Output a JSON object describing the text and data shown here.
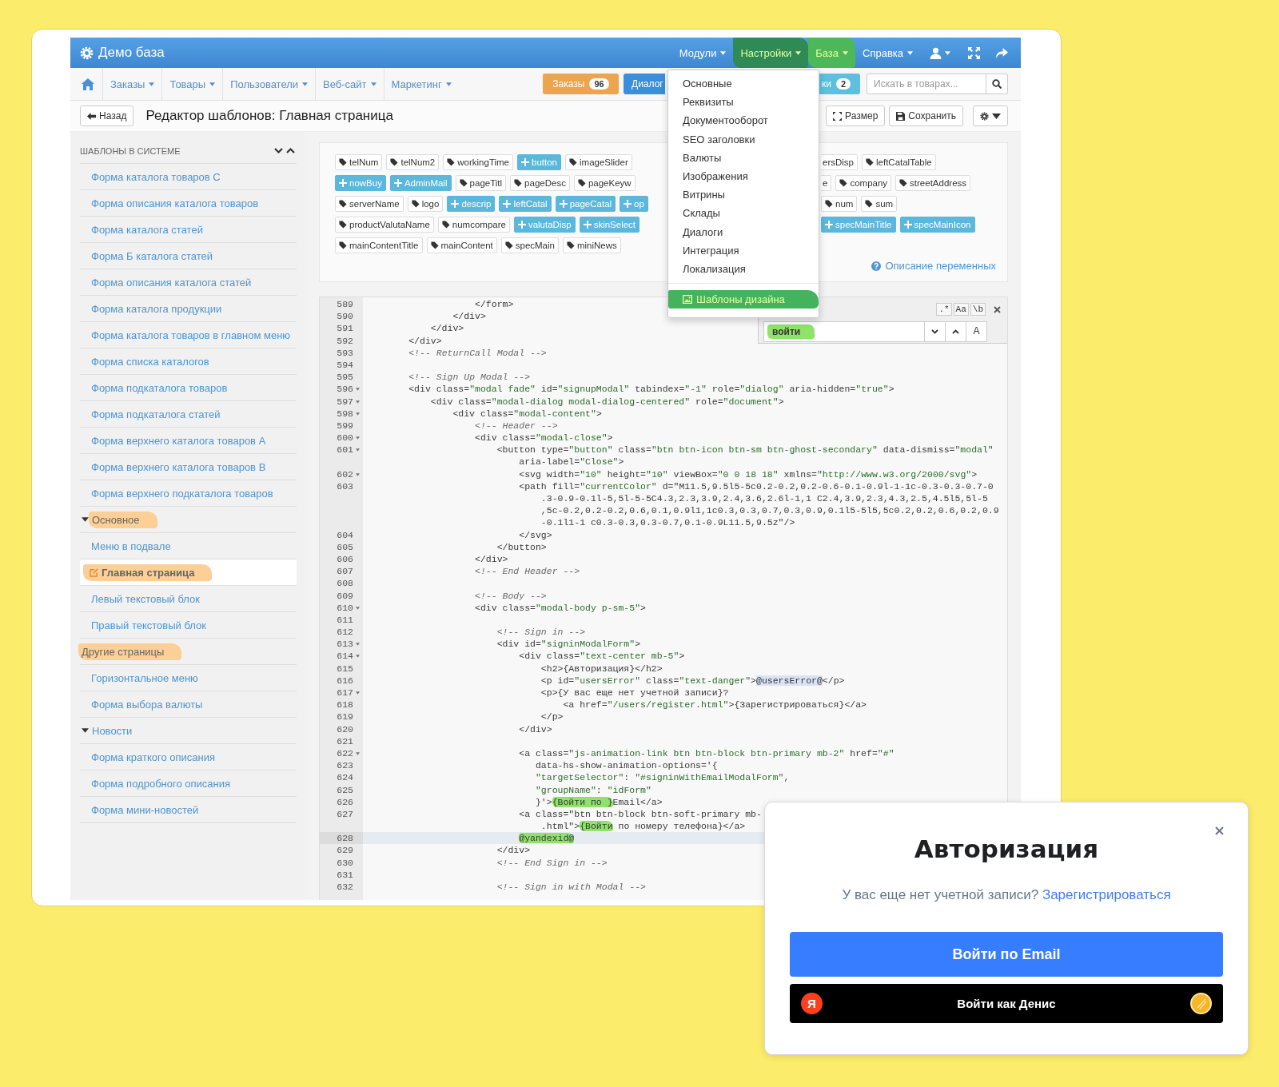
{
  "top_bar": {
    "title": "Демо база",
    "menus": [
      {
        "label": "Модули",
        "selected": false,
        "marked": false
      },
      {
        "label": "Настройки",
        "selected": true,
        "marked": true
      },
      {
        "label": "База",
        "selected": false,
        "marked": true
      },
      {
        "label": "Справка",
        "selected": false,
        "marked": false
      }
    ]
  },
  "nav": {
    "items": [
      "Заказы",
      "Товары",
      "Пользователи",
      "Веб-сайт",
      "Маркетинг"
    ],
    "buttons": [
      {
        "kind": "warning",
        "label": "Заказы",
        "count": "96"
      },
      {
        "kind": "primary",
        "label": "Диалог"
      },
      {
        "kind": "info",
        "label": "ки",
        "count": "2"
      }
    ],
    "search": {
      "placeholder": "Искать в товарах..."
    }
  },
  "page_header": {
    "back": "Назад",
    "title": "Редактор шаблонов: Главная страница",
    "actions": [
      {
        "kind": "resize",
        "label": "Размер"
      },
      {
        "kind": "save",
        "label": "Сохранить"
      },
      {
        "kind": "settings"
      }
    ]
  },
  "sidebar": {
    "title": "ШАБЛОНЫ В СИСТЕМЕ",
    "items": [
      {
        "label": "Форма каталога товаров С",
        "selected": false,
        "marked": false
      },
      {
        "label": "Форма описания каталога товаров",
        "selected": false,
        "marked": false
      },
      {
        "label": "Форма каталога статей",
        "selected": false,
        "marked": false
      },
      {
        "label": "Форма Б каталога статей",
        "selected": false,
        "marked": false
      },
      {
        "label": "Форма описания каталога статей",
        "selected": false,
        "marked": false
      },
      {
        "label": "Форма каталога продукции",
        "selected": false,
        "marked": false
      },
      {
        "label": "Форма каталога товаров в главном меню",
        "selected": false,
        "marked": false
      },
      {
        "label": "Форма списка каталогов",
        "selected": false,
        "marked": false
      },
      {
        "label": "Форма подкаталога товаров",
        "selected": false,
        "marked": false
      },
      {
        "label": "Форма подкаталога статей",
        "selected": false,
        "marked": false
      },
      {
        "label": "Форма верхнего каталога товаров А",
        "selected": false,
        "marked": false
      },
      {
        "label": "Форма верхнего каталога товаров В",
        "selected": false,
        "marked": false
      },
      {
        "label": "Форма верхнего подкаталога товаров",
        "selected": false,
        "marked": false
      },
      {
        "label": "Основное",
        "kind": "group",
        "expanded": true,
        "selected": false,
        "marked": true,
        "children": [
          {
            "label": "Меню в подвале",
            "selected": false,
            "marked": false
          },
          {
            "label": "Главная страница",
            "selected": true,
            "marked": true
          },
          {
            "label": "Левый текстовый блок",
            "selected": false,
            "marked": false
          },
          {
            "label": "Правый текстовый блок",
            "selected": false,
            "marked": false
          }
        ]
      },
      {
        "label": "Другие страницы",
        "kind": "group",
        "selected": false,
        "marked": true,
        "children": [
          {
            "label": "Горизонтальное меню",
            "selected": false,
            "marked": false
          },
          {
            "label": "Форма выбора валюты",
            "selected": false,
            "marked": false
          }
        ]
      },
      {
        "label": "Новости",
        "kind": "group",
        "expanded": true,
        "selected": false,
        "marked": false,
        "children": [
          {
            "label": "Форма краткого описания",
            "selected": false,
            "marked": false
          },
          {
            "label": "Форма подробного описания",
            "selected": false,
            "marked": false
          },
          {
            "label": "Форма мини-новостей",
            "selected": false,
            "marked": false
          }
        ]
      }
    ]
  },
  "variables": {
    "rows": [
      {
        "left": [
          {
            "kind": "var",
            "label": "telNum"
          },
          {
            "kind": "var",
            "label": "telNum2"
          },
          {
            "kind": "var",
            "label": "workingTime"
          },
          {
            "kind": "add",
            "label": "button"
          },
          {
            "kind": "var",
            "label": "imageSlider"
          }
        ],
        "right": [
          {
            "kind": "cut",
            "label": "ersDisp"
          },
          {
            "kind": "var",
            "label": "leftCatalTable"
          }
        ]
      },
      {
        "left": [
          {
            "kind": "add",
            "label": "nowBuy"
          },
          {
            "kind": "add",
            "label": "AdminMail"
          },
          {
            "kind": "var",
            "label": "pageTitl"
          },
          {
            "kind": "var",
            "label": "pageDesc"
          },
          {
            "kind": "var",
            "label": "pageKeyw"
          }
        ],
        "right": [
          {
            "kind": "cut",
            "label": "e"
          },
          {
            "kind": "var",
            "label": "company"
          },
          {
            "kind": "var",
            "label": "streetAddress"
          }
        ]
      },
      {
        "left": [
          {
            "kind": "var",
            "label": "serverName"
          },
          {
            "kind": "var",
            "label": "logo"
          },
          {
            "kind": "add",
            "label": "descrip"
          },
          {
            "kind": "add",
            "label": "leftCatal"
          },
          {
            "kind": "add",
            "label": "pageCatal"
          },
          {
            "kind": "add",
            "label": "op"
          }
        ],
        "right": [
          {
            "kind": "var",
            "label": "num"
          },
          {
            "kind": "var",
            "label": "sum"
          }
        ]
      },
      {
        "left": [
          {
            "kind": "var",
            "label": "productValutaName"
          },
          {
            "kind": "var",
            "label": "numcompare"
          },
          {
            "kind": "add",
            "label": "valutaDisp"
          },
          {
            "kind": "add",
            "label": "skinSelect"
          }
        ],
        "right": [
          {
            "kind": "add",
            "label": "specMainTitle"
          },
          {
            "kind": "add",
            "label": "specMainIcon"
          }
        ]
      },
      {
        "left": [
          {
            "kind": "var",
            "label": "mainContentTitle"
          },
          {
            "kind": "var",
            "label": "mainContent"
          },
          {
            "kind": "var",
            "label": "specMain"
          },
          {
            "kind": "var",
            "label": "miniNews"
          }
        ],
        "right": []
      }
    ],
    "help_link": "Описание переменных"
  },
  "settings_menu": {
    "items": [
      {
        "kind": "item",
        "label": "Основные",
        "selected": false,
        "marked": false
      },
      {
        "kind": "item",
        "label": "Реквизиты",
        "selected": false,
        "marked": false
      },
      {
        "kind": "item",
        "label": "Документооборот",
        "selected": false,
        "marked": false
      },
      {
        "kind": "item",
        "label": "SEO заголовки",
        "selected": false,
        "marked": false
      },
      {
        "kind": "item",
        "label": "Валюты",
        "selected": false,
        "marked": false
      },
      {
        "kind": "item",
        "label": "Изображения",
        "selected": false,
        "marked": false
      },
      {
        "kind": "item",
        "label": "Витрины",
        "selected": false,
        "marked": false
      },
      {
        "kind": "item",
        "label": "Склады",
        "selected": false,
        "marked": false
      },
      {
        "kind": "item",
        "label": "Диалоги",
        "selected": false,
        "marked": false
      },
      {
        "kind": "item",
        "label": "Интеграция",
        "selected": false,
        "marked": false
      },
      {
        "kind": "item",
        "label": "Локализация",
        "selected": false,
        "marked": false
      },
      {
        "kind": "divider"
      },
      {
        "kind": "item",
        "label": "Шаблоны дизайна",
        "selected": true,
        "marked": true
      }
    ]
  },
  "editor": {
    "search": {
      "options": [
        ".*",
        "Aa",
        "\\b"
      ],
      "value": "войти",
      "marked": true,
      "button": "A"
    },
    "lines": [
      {
        "num": "589",
        "fold": false,
        "active": false,
        "text": "                    </form>"
      },
      {
        "num": "590",
        "fold": false,
        "active": false,
        "text": "                </div>"
      },
      {
        "num": "591",
        "fold": false,
        "active": false,
        "text": "            </div>"
      },
      {
        "num": "592",
        "fold": false,
        "active": false,
        "text": "        </div>"
      },
      {
        "num": "593",
        "fold": false,
        "active": false,
        "text": "        <!-- ReturnCall Modal -->"
      },
      {
        "num": "594",
        "fold": false,
        "active": false
      },
      {
        "num": "595",
        "fold": false,
        "active": false,
        "text": "        <!-- Sign Up Modal -->"
      },
      {
        "num": "596",
        "fold": true,
        "active": false,
        "text": "        <div class=\"modal fade\" id=\"signupModal\" tabindex=\"-1\" role=\"dialog\" aria-hidden=\"true\">"
      },
      {
        "num": "597",
        "fold": true,
        "active": false,
        "text": "            <div class=\"modal-dialog modal-dialog-centered\" role=\"document\">"
      },
      {
        "num": "598",
        "fold": true,
        "active": false,
        "text": "                <div class=\"modal-content\">"
      },
      {
        "num": "599",
        "fold": false,
        "active": false,
        "text": "                    <!-- Header -->"
      },
      {
        "num": "600",
        "fold": true,
        "active": false,
        "text": "                    <div class=\"modal-close\">"
      },
      {
        "num": "601",
        "fold": true,
        "active": false,
        "text": "                        <button type=\"button\" class=\"btn btn-icon btn-sm btn-ghost-secondary\" data-dismiss=\"modal\""
      },
      {
        "fold": false,
        "active": false,
        "text": "                            aria-label=\"Close\">"
      },
      {
        "num": "602",
        "fold": true,
        "active": false,
        "text": "                            <svg width=\"10\" height=\"10\" viewBox=\"0 0 18 18\" xmlns=\"http://www.w3.org/2000/svg\">"
      },
      {
        "num": "603",
        "fold": false,
        "active": false,
        "text": "                            <path fill=\"currentColor\" d=\"M11.5,9.5l5-5c0.2-0.2,0.2-0.6-0.1-0.9l-1-1c-0.3-0.3-0.7-0"
      },
      {
        "fold": false,
        "active": false,
        "text": "                                .3-0.9-0.1l-5,5l-5-5C4.3,2.3,3.9,2.4,3.6,2.6l-1,1 C2.4,3.9,2.3,4.3,2.5,4.5l5,5l-5"
      },
      {
        "fold": false,
        "active": false,
        "text": "                                ,5c-0.2,0.2-0.2,0.6,0.1,0.9l1,1c0.3,0.3,0.7,0.3,0.9,0.1l5-5l5,5c0.2,0.2,0.6,0.2,0.9"
      },
      {
        "fold": false,
        "active": false,
        "text": "                                -0.1l1-1 c0.3-0.3,0.3-0.7,0.1-0.9L11.5,9.5z\"/>"
      },
      {
        "num": "604",
        "fold": false,
        "active": false,
        "text": "                            </svg>"
      },
      {
        "num": "605",
        "fold": false,
        "active": false,
        "text": "                        </button>"
      },
      {
        "num": "606",
        "fold": false,
        "active": false,
        "text": "                    </div>"
      },
      {
        "num": "607",
        "fold": false,
        "active": false,
        "text": "                    <!-- End Header -->"
      },
      {
        "num": "608",
        "fold": false,
        "active": false
      },
      {
        "num": "609",
        "fold": false,
        "active": false,
        "text": "                    <!-- Body -->"
      },
      {
        "num": "610",
        "fold": true,
        "active": false,
        "text": "                    <div class=\"modal-body p-sm-5\">"
      },
      {
        "num": "611",
        "fold": false,
        "active": false
      },
      {
        "num": "612",
        "fold": false,
        "active": false,
        "text": "                        <!-- Sign in -->"
      },
      {
        "num": "613",
        "fold": true,
        "active": false,
        "text": "                        <div id=\"signinModalForm\">"
      },
      {
        "num": "614",
        "fold": true,
        "active": false,
        "text": "                            <div class=\"text-center mb-5\">"
      },
      {
        "num": "615",
        "fold": false,
        "active": false,
        "text": "                                <h2>{Авторизация}</h2>"
      },
      {
        "num": "616",
        "fold": false,
        "active": false,
        "parts": [
          {
            "text": "                                <p id=\"usersError\" class=\"text-danger\">"
          },
          {
            "text": "@usersError@",
            "match": true
          },
          {
            "text": "</p>"
          }
        ]
      },
      {
        "num": "617",
        "fold": true,
        "active": false,
        "text": "                                <p>{У вас еще нет учетной записи}?"
      },
      {
        "num": "618",
        "fold": false,
        "active": false,
        "text": "                                    <a href=\"/users/register.html\">{Зарегистрироваться}</a>"
      },
      {
        "num": "619",
        "fold": false,
        "active": false,
        "text": "                                </p>"
      },
      {
        "num": "620",
        "fold": false,
        "active": false,
        "text": "                            </div>"
      },
      {
        "num": "621",
        "fold": false,
        "active": false
      },
      {
        "num": "622",
        "fold": true,
        "active": false,
        "text": "                            <a class=\"js-animation-link btn btn-block btn-primary mb-2\" href=\"#\""
      },
      {
        "num": "623",
        "fold": false,
        "active": false,
        "text": "                               data-hs-show-animation-options='{"
      },
      {
        "num": "624",
        "fold": false,
        "active": false,
        "text": "                               \"targetSelector\": \"#signinWithEmailModalForm\","
      },
      {
        "num": "625",
        "fold": false,
        "active": false,
        "text": "                               \"groupName\": \"idForm\""
      },
      {
        "num": "626",
        "fold": false,
        "active": false,
        "parts": [
          {
            "text": "                               }'>"
          },
          {
            "text": "{Войти по }",
            "marked": true
          },
          {
            "text": "Email</a>"
          }
        ]
      },
      {
        "num": "627",
        "fold": false,
        "active": false,
        "text": "                            <a class=\"btn btn-block btn-soft-primary mb-"
      },
      {
        "fold": false,
        "active": false,
        "parts": [
          {
            "text": "                                .html\">"
          },
          {
            "text": "{Войти",
            "marked": true
          },
          {
            "text": " по номеру телефона}</a>"
          }
        ]
      },
      {
        "num": "628",
        "fold": false,
        "active": true,
        "parts": [
          {
            "text": "                            @yandexid@",
            "marked": true
          }
        ]
      },
      {
        "num": "629",
        "fold": false,
        "active": false,
        "text": "                        </div>"
      },
      {
        "num": "630",
        "fold": false,
        "active": false,
        "text": "                        <!-- End Sign in -->"
      },
      {
        "num": "631",
        "fold": false,
        "active": false
      },
      {
        "num": "632",
        "fold": false,
        "active": false,
        "text": "                        <!-- Sign in with Modal -->"
      }
    ]
  },
  "login_modal": {
    "title": "Авторизация",
    "prompt": "У вас еще нет учетной записи?",
    "link": "Зарегистрироваться",
    "buttons": [
      {
        "kind": "email",
        "label": "Войти по Email"
      },
      {
        "kind": "yandex",
        "label": "Войти как Денис",
        "badge": "Я"
      }
    ]
  }
}
